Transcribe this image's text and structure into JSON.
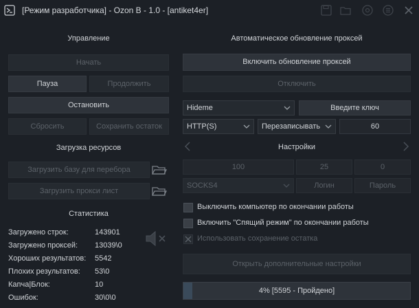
{
  "window": {
    "title": "[Режим разработчика] - Ozon B - 1.0 - [antiket4er]"
  },
  "control": {
    "header": "Управление",
    "start_label": "Начать",
    "pause_label": "Пауза",
    "continue_label": "Продолжить",
    "stop_label": "Остановить",
    "reset_label": "Сбросить",
    "save_rest_label": "Сохранить остаток"
  },
  "resources": {
    "header": "Загрузка ресурсов",
    "load_base_label": "Загрузить базу для перебора",
    "load_proxy_label": "Загрузить прокси лист"
  },
  "stats": {
    "header": "Статистика",
    "rows": [
      {
        "label": "Загружено строк:",
        "value": "143901"
      },
      {
        "label": "Загружено проксей:",
        "value": "13039\\0"
      },
      {
        "label": "Хороших результатов:",
        "value": "5542"
      },
      {
        "label": "Плохих результатов:",
        "value": "53\\0"
      },
      {
        "label": "Капча|Блок:",
        "value": "10"
      },
      {
        "label": "Ошибок:",
        "value": "30\\0\\0"
      }
    ]
  },
  "proxy_update": {
    "header": "Автоматическое обновление проксей",
    "enable_label": "Включить обновление проксей",
    "disable_label": "Отключить",
    "provider_value": "Hideme",
    "key_label": "Введите ключ",
    "protocol_value": "HTTP(S)",
    "mode_value": "Перезаписывать",
    "interval_value": "60"
  },
  "settings": {
    "header": "Настройки",
    "field1": "100",
    "field2": "25",
    "field3": "0",
    "proxy_type_value": "SOCKS4",
    "login_label": "Логин",
    "password_label": "Пароль",
    "checkboxes": [
      {
        "label": "Выключить компьютер по окончании работы"
      },
      {
        "label": "Включить \"Спящий режим\" по окончании работы"
      },
      {
        "label": "Использовать сохранение остатка"
      }
    ],
    "advanced_label": "Открыть дополнительные настройки"
  },
  "progress": {
    "text": "4% [5595 - Пройдено]",
    "percent": 4
  }
}
